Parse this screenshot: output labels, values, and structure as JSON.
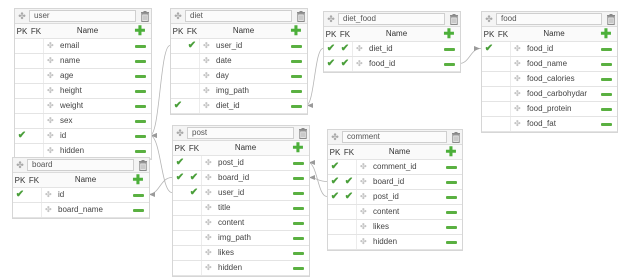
{
  "colors": {
    "accent": "#5ab041",
    "check": "#4a9f3a",
    "border": "#d6d6d6"
  },
  "tables": [
    {
      "id": "user",
      "name": "user",
      "columns": {
        "pk": "PK",
        "fk": "FK",
        "name": "Name"
      },
      "fields": [
        {
          "name": "email",
          "pk": false,
          "fk": false
        },
        {
          "name": "name",
          "pk": false,
          "fk": false
        },
        {
          "name": "age",
          "pk": false,
          "fk": false
        },
        {
          "name": "height",
          "pk": false,
          "fk": false
        },
        {
          "name": "weight",
          "pk": false,
          "fk": false
        },
        {
          "name": "sex",
          "pk": false,
          "fk": false
        },
        {
          "name": "id",
          "pk": true,
          "fk": false
        },
        {
          "name": "hidden",
          "pk": false,
          "fk": false
        }
      ]
    },
    {
      "id": "diet",
      "name": "diet",
      "columns": {
        "pk": "PK",
        "fk": "FK",
        "name": "Name"
      },
      "fields": [
        {
          "name": "user_id",
          "pk": false,
          "fk": true
        },
        {
          "name": "date",
          "pk": false,
          "fk": false
        },
        {
          "name": "day",
          "pk": false,
          "fk": false
        },
        {
          "name": "img_path",
          "pk": false,
          "fk": false
        },
        {
          "name": "diet_id",
          "pk": true,
          "fk": false
        }
      ]
    },
    {
      "id": "diet_food",
      "name": "diet_food",
      "columns": {
        "pk": "PK",
        "fk": "FK",
        "name": "Name"
      },
      "fields": [
        {
          "name": "diet_id",
          "pk": true,
          "fk": true
        },
        {
          "name": "food_id",
          "pk": true,
          "fk": true
        }
      ]
    },
    {
      "id": "food",
      "name": "food",
      "columns": {
        "pk": "PK",
        "fk": "FK",
        "name": "Name"
      },
      "fields": [
        {
          "name": "food_id",
          "pk": true,
          "fk": false
        },
        {
          "name": "food_name",
          "pk": false,
          "fk": false
        },
        {
          "name": "food_calories",
          "pk": false,
          "fk": false
        },
        {
          "name": "food_carbohydar",
          "pk": false,
          "fk": false
        },
        {
          "name": "food_protein",
          "pk": false,
          "fk": false
        },
        {
          "name": "food_fat",
          "pk": false,
          "fk": false
        }
      ]
    },
    {
      "id": "board",
      "name": "board",
      "columns": {
        "pk": "PK",
        "fk": "FK",
        "name": "Name"
      },
      "fields": [
        {
          "name": "id",
          "pk": true,
          "fk": false
        },
        {
          "name": "board_name",
          "pk": false,
          "fk": false
        }
      ]
    },
    {
      "id": "post",
      "name": "post",
      "columns": {
        "pk": "PK",
        "fk": "FK",
        "name": "Name"
      },
      "fields": [
        {
          "name": "post_id",
          "pk": true,
          "fk": false
        },
        {
          "name": "board_id",
          "pk": true,
          "fk": true
        },
        {
          "name": "user_id",
          "pk": false,
          "fk": true
        },
        {
          "name": "title",
          "pk": false,
          "fk": false
        },
        {
          "name": "content",
          "pk": false,
          "fk": false
        },
        {
          "name": "img_path",
          "pk": false,
          "fk": false
        },
        {
          "name": "likes",
          "pk": false,
          "fk": false
        },
        {
          "name": "hidden",
          "pk": false,
          "fk": false
        }
      ]
    },
    {
      "id": "comment",
      "name": "comment",
      "columns": {
        "pk": "PK",
        "fk": "FK",
        "name": "Name"
      },
      "fields": [
        {
          "name": "comment_id",
          "pk": true,
          "fk": false
        },
        {
          "name": "board_id",
          "pk": true,
          "fk": true
        },
        {
          "name": "post_id",
          "pk": true,
          "fk": true
        },
        {
          "name": "content",
          "pk": false,
          "fk": false
        },
        {
          "name": "likes",
          "pk": false,
          "fk": false
        },
        {
          "name": "hidden",
          "pk": false,
          "fk": false
        }
      ]
    }
  ],
  "relations": [
    {
      "from_table": "user",
      "from_field": "id",
      "to_table": "diet",
      "to_field": "user_id"
    },
    {
      "from_table": "user",
      "from_field": "id",
      "to_table": "post",
      "to_field": "user_id"
    },
    {
      "from_table": "diet",
      "from_field": "diet_id",
      "to_table": "diet_food",
      "to_field": "diet_id"
    },
    {
      "from_table": "food",
      "from_field": "food_id",
      "to_table": "diet_food",
      "to_field": "food_id"
    },
    {
      "from_table": "board",
      "from_field": "id",
      "to_table": "post",
      "to_field": "board_id"
    },
    {
      "from_table": "post",
      "from_field": "post_id",
      "to_table": "comment",
      "to_field": "post_id"
    },
    {
      "from_table": "post",
      "from_field": "board_id",
      "to_table": "comment",
      "to_field": "board_id"
    }
  ]
}
